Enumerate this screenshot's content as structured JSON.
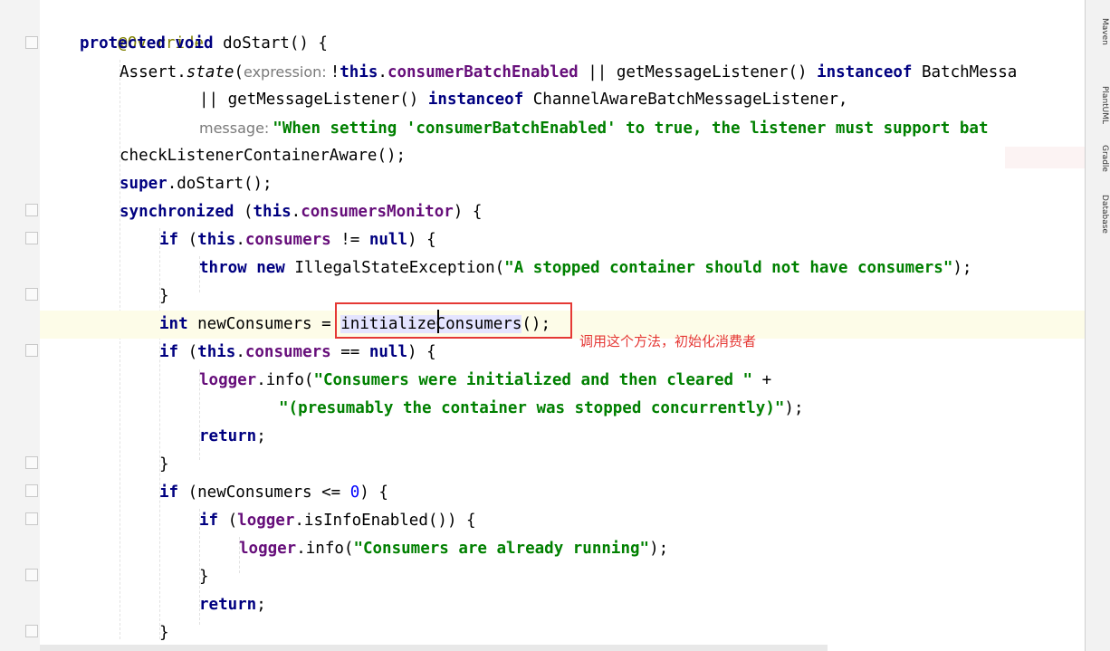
{
  "code": {
    "annotation": "@Override",
    "l2_kw1": "protected",
    "l2_kw2": "void",
    "l2_rest": " doStart() {",
    "l3_a": "Assert.",
    "l3_state": "state",
    "l3_paren": "(",
    "l3_hint": "expression:",
    "l3_not": "!",
    "l3_this": "this",
    "l3_dot": ".",
    "l3_field": "consumerBatchEnabled",
    "l3_mid": " || getMessageListener() ",
    "l3_inst": "instanceof",
    "l3_end": " BatchMessa",
    "l4_mid": "|| getMessageListener() ",
    "l4_inst": "instanceof",
    "l4_end": " ChannelAwareBatchMessageListener,",
    "l5_hint": "message:",
    "l5_str": "\"When setting 'consumerBatchEnabled' to true, the listener must support bat",
    "l6": "checkListenerContainerAware();",
    "l7_kw": "super",
    "l7_rest": ".doStart();",
    "l8_kw": "synchronized",
    "l8_a": " (",
    "l8_this": "this",
    "l8_dot": ".",
    "l8_field": "consumersMonitor",
    "l8_end": ") {",
    "l9_if": "if",
    "l9_a": " (",
    "l9_this": "this",
    "l9_dot": ".",
    "l9_field": "consumers",
    "l9_op": " != ",
    "l9_null": "null",
    "l9_end": ") {",
    "l10_throw": "throw",
    "l10_new": "new",
    "l10_cls": " IllegalStateException(",
    "l10_str": "\"A stopped container should not have consumers\"",
    "l10_end": ");",
    "close": "}",
    "l12_int": "int",
    "l12_a": " newConsumers = ",
    "l12_call": "initializeConsumers",
    "l12_end": "();",
    "l13_if": "if",
    "l13_a": " (",
    "l13_this": "this",
    "l13_dot": ".",
    "l13_field": "consumers",
    "l13_op": " == ",
    "l13_null": "null",
    "l13_end": ") {",
    "l14_a": "logger",
    "l14_b": ".info(",
    "l14_str": "\"Consumers were initialized and then cleared \"",
    "l14_end": " +",
    "l15_str": "\"(presumably the container was stopped concurrently)\"",
    "l15_end": ");",
    "l16_ret": "return",
    "l16_end": ";",
    "l18_if": "if",
    "l18_a": " (newConsumers <= ",
    "l18_num": "0",
    "l18_end": ") {",
    "l19_if": "if",
    "l19_a": " (",
    "l19_logger": "logger",
    "l19_end": ".isInfoEnabled()) {",
    "l20_a": "logger",
    "l20_b": ".info(",
    "l20_str": "\"Consumers are already running\"",
    "l20_end": ");",
    "l22_ret": "return",
    "l22_end": ";"
  },
  "callout": {
    "text": "调用这个方法，初始化消费者",
    "color": "#e53935"
  },
  "tool_windows": [
    "Maven",
    "PlantUML",
    "Gradle",
    "Database"
  ]
}
